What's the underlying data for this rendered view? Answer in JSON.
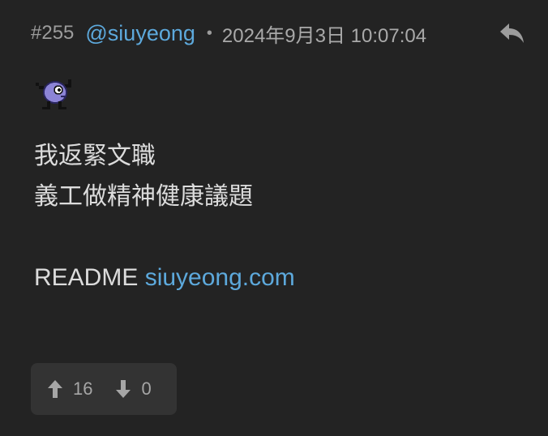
{
  "post": {
    "number": "#255",
    "username": "@siuyeong",
    "separator": "•",
    "timestamp": "2024年9月3日 10:07:04"
  },
  "icons": {
    "reply": "reply-arrow-icon",
    "sticker": "purple-creature-sticker",
    "upvote": "arrow-up-icon",
    "downvote": "arrow-down-icon"
  },
  "content": {
    "line1": "我返緊文職",
    "line2": "義工做精神健康議題",
    "readme_prefix": "README ",
    "readme_link": "siuyeong.com"
  },
  "votes": {
    "up_count": "16",
    "down_count": "0"
  },
  "colors": {
    "background": "#232323",
    "accent_link": "#5da9dc",
    "muted_text": "#a9a9a9",
    "body_text": "#dcdcdc",
    "vote_box": "#333333"
  }
}
